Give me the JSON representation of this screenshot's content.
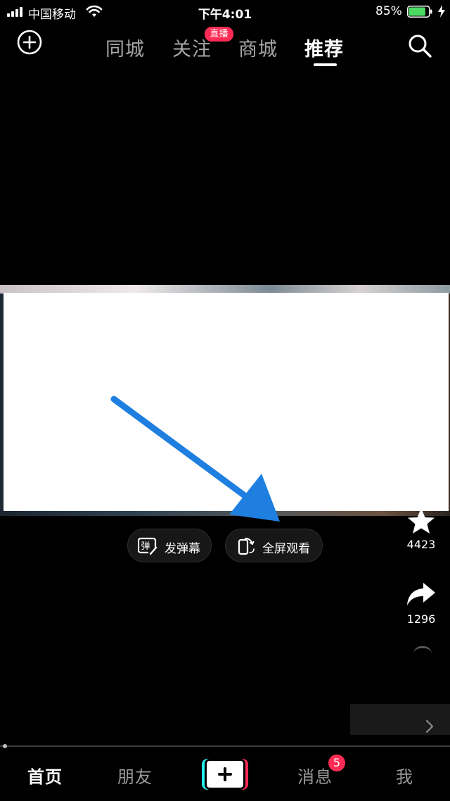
{
  "status_bar": {
    "carrier": "中国移动",
    "time": "下午4:01",
    "battery_percent": "85%",
    "battery_level": 0.85,
    "signal_bars": 4,
    "charging": true
  },
  "top_nav": {
    "tabs": [
      {
        "label": "同城"
      },
      {
        "label": "关注"
      },
      {
        "label": "商城"
      },
      {
        "label": "推荐"
      }
    ],
    "active_tab": "推荐",
    "live_badge": "直播",
    "icons": {
      "add": "plus-circle-icon",
      "search": "search-icon"
    }
  },
  "video": {
    "actions": {
      "danmaku": {
        "label": "发弹幕",
        "icon_char": "弹"
      },
      "fullscreen": {
        "label": "全屏观看"
      }
    },
    "annotation_arrow_color": "#1e7fe0"
  },
  "side_actions": {
    "favorite": {
      "count": "4423",
      "icon": "star-icon"
    },
    "share": {
      "count": "1296",
      "icon": "share-arrow-icon"
    }
  },
  "tab_bar": {
    "items": [
      {
        "label": "首页"
      },
      {
        "label": "朋友"
      },
      {
        "label": "消息"
      },
      {
        "label": "我"
      }
    ],
    "active": "首页",
    "message_badge": "5",
    "create_icon": "plus-icon"
  },
  "colors": {
    "accent": "#fe2c55",
    "cyan": "#25f4ee",
    "battery": "#4cd964",
    "arrow": "#1e7fe0"
  }
}
